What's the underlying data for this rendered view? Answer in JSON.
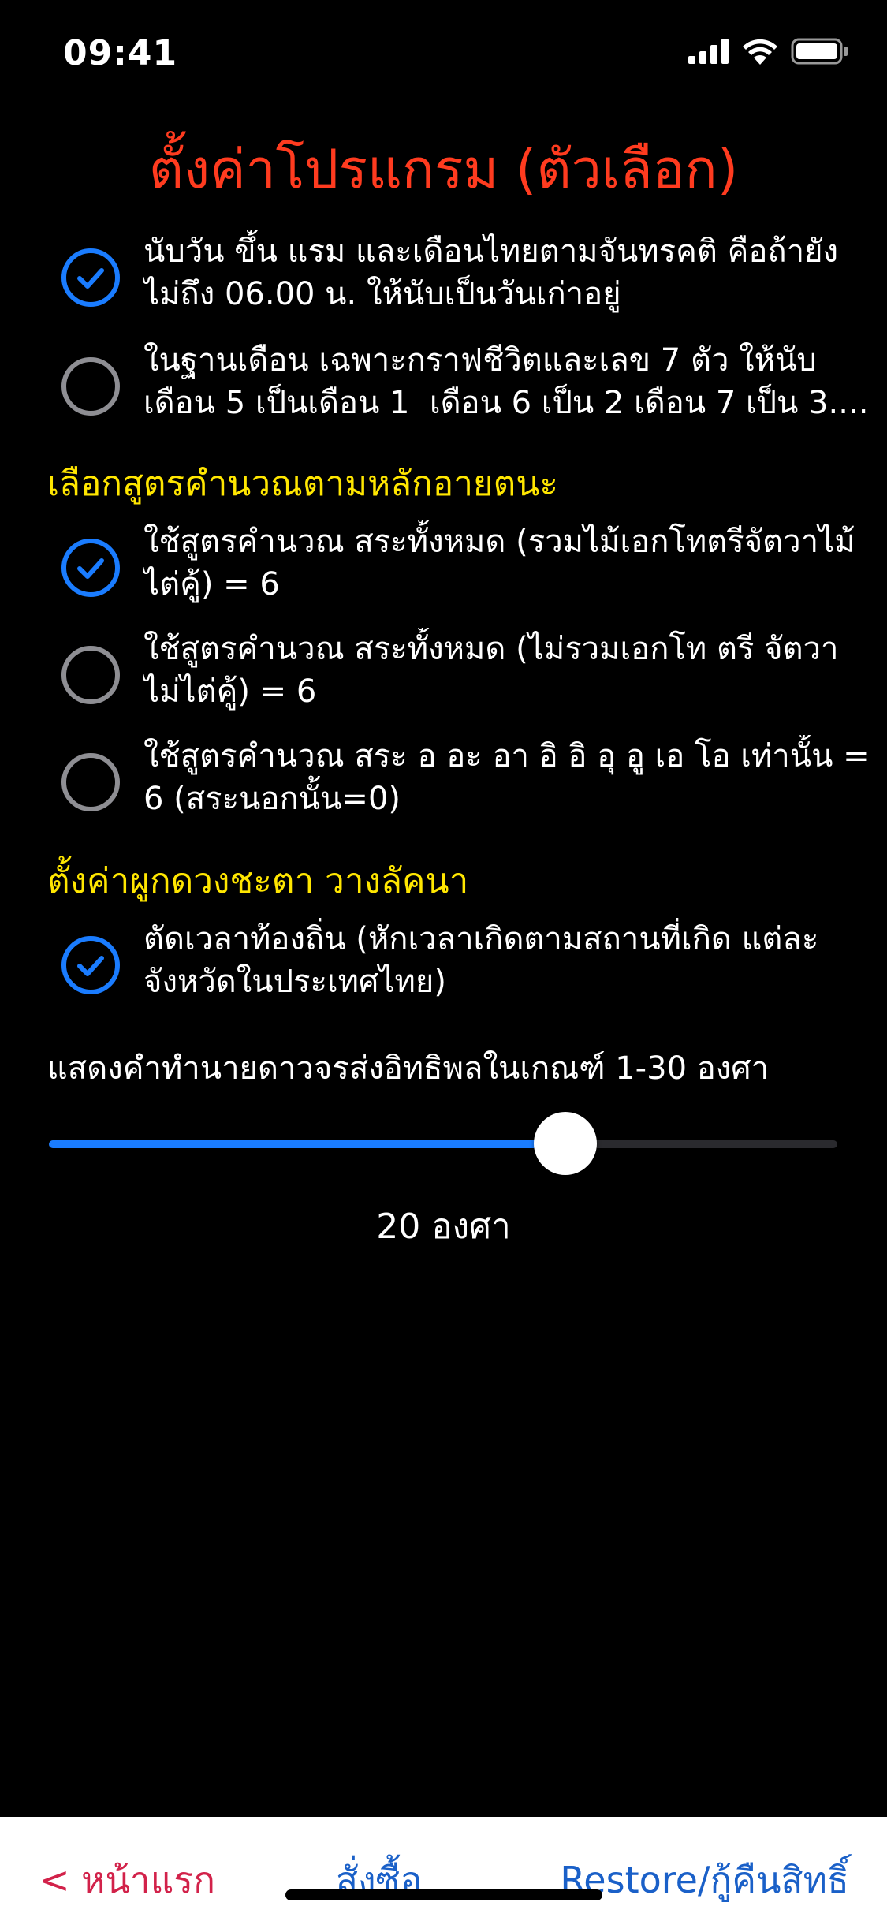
{
  "status_bar": {
    "time": "09:41",
    "icons": [
      "signal-icon",
      "wifi-icon",
      "battery-icon"
    ]
  },
  "title": "ตั้งค่าโปรแกรม (ตัวเลือก)",
  "colors": {
    "title": "#ff3b1f",
    "section": "#ffe600",
    "accent": "#1a7cff",
    "unchecked": "#8e8e93",
    "home_button": "#d2224a",
    "link_button": "#1a60c8"
  },
  "general_options": [
    {
      "text": "นับวัน ขึ้น แรม และเดือนไทยตามจันทรคติ คือถ้ายัง\nไม่ถึง 06.00 น. ให้นับเป็นวันเก่าอยู่",
      "checked": true
    },
    {
      "text": "ในฐานเดือน เฉพาะกราฟชีวิตและเลข 7 ตัว ให้นับ\nเดือน 5 เป็นเดือน 1  เดือน 6 เป็น 2 เดือน 7 เป็น 3....",
      "checked": false
    }
  ],
  "formula_section": {
    "title": "เลือกสูตรคำนวณตามหลักอายตนะ",
    "options": [
      {
        "text": "ใช้สูตรคำนวณ สระทั้งหมด (รวมไม้เอกโทตรีจัตวาไม้\nไต่คู้) = 6",
        "checked": true
      },
      {
        "text": "ใช้สูตรคำนวณ สระทั้งหมด (ไม่รวมเอกโท ตรี จัตวา\nไม่ไต่คู้) = 6",
        "checked": false
      },
      {
        "text": "ใช้สูตรคำนวณ สระ อ อะ อา อิ อิ อุ อู เอ โอ เท่านั้น =\n6 (สระนอกนั้น=0)",
        "checked": false
      }
    ]
  },
  "horoscope_section": {
    "title": "ตั้งค่าผูกดวงชะตา วางลัคนา",
    "options": [
      {
        "text": "ตัดเวลาท้องถิ่น (หักเวลาเกิดตามสถานที่เกิด แต่ละ\nจังหวัดในประเทศไทย)",
        "checked": true
      }
    ]
  },
  "slider": {
    "label": "แสดงคำทำนายดาวจรส่งอิทธิพลในเกณฑ์ 1-30 องศา",
    "min": 1,
    "max": 30,
    "value": 20,
    "value_text": "20 องศา"
  },
  "bottom_bar": {
    "home": "< หน้าแรก",
    "buy": "สั่งซื้อ",
    "restore": "Restore/กู้คืนสิทธิ์"
  }
}
